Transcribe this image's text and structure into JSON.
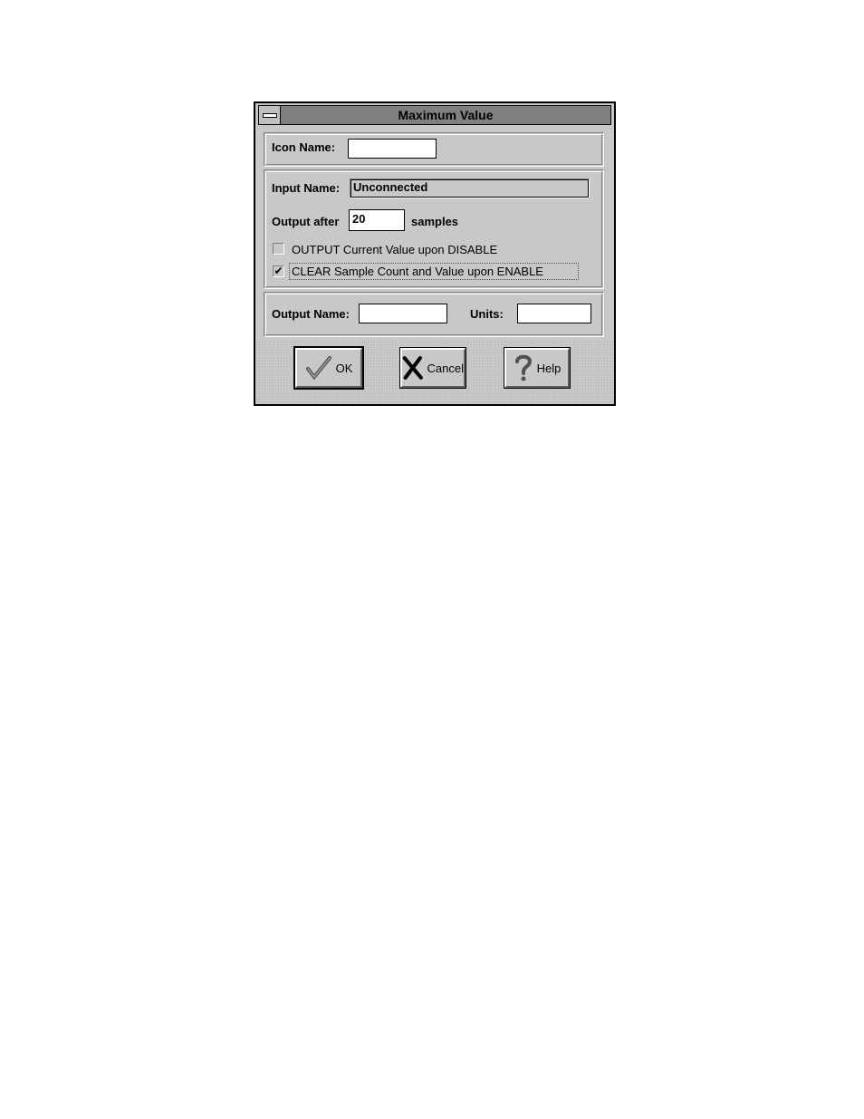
{
  "window": {
    "title": "Maximum Value"
  },
  "icon_section": {
    "icon_name_label": "Icon Name:",
    "icon_name_value": ""
  },
  "input_section": {
    "input_name_label": "Input Name:",
    "input_name_value": "Unconnected",
    "output_after_label": "Output after",
    "output_after_value": "20",
    "samples_label": "samples",
    "checkbox_output_disable": {
      "label": "OUTPUT Current Value upon DISABLE",
      "checked": false
    },
    "checkbox_clear_enable": {
      "label": "CLEAR Sample Count and Value upon ENABLE",
      "checked": true
    }
  },
  "output_section": {
    "output_name_label": "Output Name:",
    "output_name_value": "",
    "units_label": "Units:",
    "units_value": ""
  },
  "buttons": {
    "ok_label": "OK",
    "cancel_label": "Cancel",
    "help_label": "Help"
  },
  "icons": {
    "ok": "checkmark-icon",
    "cancel": "x-mark-icon",
    "help": "question-mark-icon",
    "checked_glyph": "✔"
  }
}
